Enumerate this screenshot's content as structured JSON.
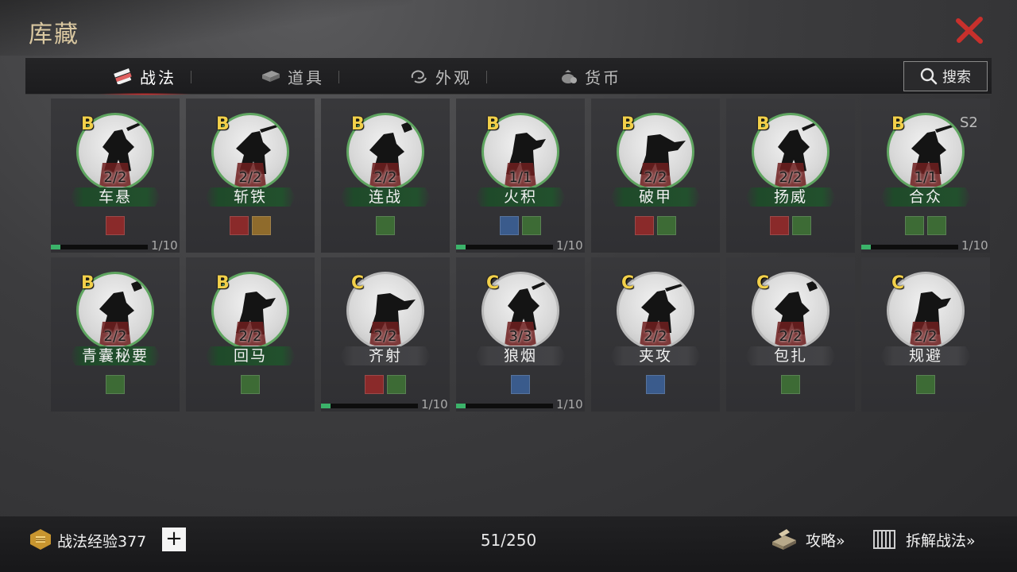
{
  "header": {
    "title": "库藏",
    "close_icon": "close-x-icon",
    "accent": "#c8302c"
  },
  "tabs": [
    {
      "label": "战法",
      "icon": "scroll-bundle-icon",
      "active": true
    },
    {
      "label": "道具",
      "icon": "book-icon",
      "active": false
    },
    {
      "label": "外观",
      "icon": "swirl-icon",
      "active": false
    },
    {
      "label": "货币",
      "icon": "money-bag-icon",
      "active": false
    }
  ],
  "search": {
    "label": "搜索",
    "icon": "search-icon"
  },
  "cards": [
    {
      "grade": "B",
      "count": "2/2",
      "name": "车悬",
      "tags": [
        "red"
      ],
      "progress_label": "1/10",
      "progress": 0.1,
      "border": "green"
    },
    {
      "grade": "B",
      "count": "2/2",
      "name": "斩铁",
      "tags": [
        "red",
        "gold"
      ],
      "border": "green"
    },
    {
      "grade": "B",
      "count": "2/2",
      "name": "连战",
      "tags": [
        "green"
      ],
      "border": "green"
    },
    {
      "grade": "B",
      "count": "1/1",
      "name": "火积",
      "tags": [
        "blue",
        "green"
      ],
      "progress_label": "1/10",
      "progress": 0.1,
      "border": "green"
    },
    {
      "grade": "B",
      "count": "2/2",
      "name": "破甲",
      "tags": [
        "red",
        "green"
      ],
      "border": "green"
    },
    {
      "grade": "B",
      "count": "2/2",
      "name": "扬威",
      "tags": [
        "red",
        "green"
      ],
      "border": "green"
    },
    {
      "grade": "B",
      "count": "1/1",
      "name": "合众",
      "tags": [
        "green",
        "green"
      ],
      "progress_label": "1/10",
      "progress": 0.1,
      "season": "S2",
      "border": "green"
    },
    {
      "grade": "B",
      "count": "2/2",
      "name": "青囊秘要",
      "tags": [
        "green"
      ],
      "border": "green"
    },
    {
      "grade": "B",
      "count": "2/2",
      "name": "回马",
      "tags": [
        "green"
      ],
      "border": "green"
    },
    {
      "grade": "C",
      "count": "2/2",
      "name": "齐射",
      "tags": [
        "red",
        "green"
      ],
      "progress_label": "1/10",
      "progress": 0.1,
      "border": "gray"
    },
    {
      "grade": "C",
      "count": "3/3",
      "name": "狼烟",
      "tags": [
        "blue"
      ],
      "progress_label": "1/10",
      "progress": 0.1,
      "border": "gray"
    },
    {
      "grade": "C",
      "count": "2/2",
      "name": "夹攻",
      "tags": [
        "blue"
      ],
      "border": "gray"
    },
    {
      "grade": "C",
      "count": "2/2",
      "name": "包扎",
      "tags": [
        "green"
      ],
      "border": "gray"
    },
    {
      "grade": "C",
      "count": "2/2",
      "name": "规避",
      "tags": [
        "green"
      ],
      "border": "gray"
    }
  ],
  "footer": {
    "exp_label": "战法经验377",
    "exp_icon": "fist-scroll-icon",
    "plus_label": "+",
    "capacity": "51/250",
    "strategy_label": "攻略»",
    "strategy_icon": "book-stack-icon",
    "dismantle_label": "拆解战法»",
    "dismantle_icon": "bamboo-scroll-icon"
  }
}
